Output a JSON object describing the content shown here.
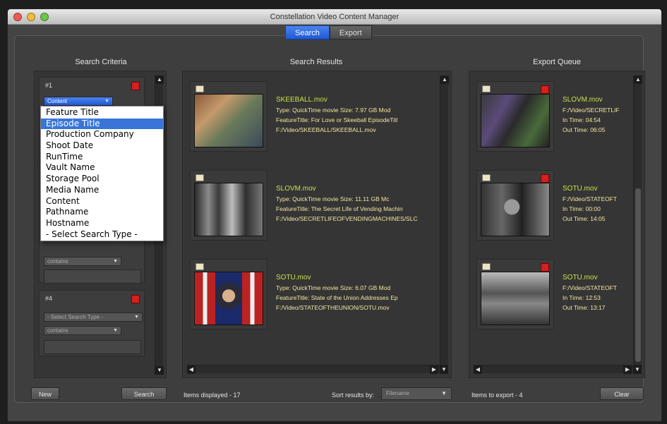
{
  "window": {
    "title": "Constellation Video Content Manager"
  },
  "tabs": [
    {
      "label": "Search",
      "active": true
    },
    {
      "label": "Export",
      "active": false
    }
  ],
  "sections": {
    "criteria": "Search Criteria",
    "results": "Search Results",
    "export": "Export Queue"
  },
  "criteria": [
    {
      "number": "#1",
      "type": "Content"
    },
    {
      "number": "",
      "type": "contains"
    },
    {
      "number": "#4",
      "type": "- Select Search Type -",
      "op": "contains"
    }
  ],
  "dropdown": {
    "selected_index": 1,
    "items": [
      "Feature Title",
      "Episode Title",
      "Production Company",
      "Shoot Date",
      "RunTime",
      "Vault Name",
      "Storage Pool",
      "Media Name",
      "Content",
      "Pathname",
      "Hostname",
      "- Select Search Type -"
    ]
  },
  "results": [
    {
      "filename": "SKEEBALL.mov",
      "line1": "Type: QuickTime movie   Size: 7.97 GB   Mod",
      "line2": "FeatureTitle: For Love or Skeeball   EpisodeTitl",
      "line3": "F:/Video/SKEEBALL/SKEEBALL.mov"
    },
    {
      "filename": "SLOVM.mov",
      "line1": "Type: QuickTime movie   Size: 11.11 GB   Mc",
      "line2": "FeatureTitle: The Secret Life of Vending Machin",
      "line3": "F:/Video/SECRETLIFEOFVENDINGMACHINES/SLC"
    },
    {
      "filename": "SOTU.mov",
      "line1": "Type: QuickTime movie   Size: 6.07 GB   Mod",
      "line2": "FeatureTitle: State of the Union Addresses   Ep",
      "line3": "F:/Video/STATEOFTHEUNION/SOTU.mov"
    }
  ],
  "export_queue": [
    {
      "filename": "SLOVM.mov",
      "path": "F:/Video/SECRETLIF",
      "in_time": "In Time: 04:54",
      "out_time": "Out Time: 06:05"
    },
    {
      "filename": "SOTU.mov",
      "path": "F:/Video/STATEOFT",
      "in_time": "In Time: 00:00",
      "out_time": "Out Time: 14:05"
    },
    {
      "filename": "SOTU.mov",
      "path": "F:/Video/STATEOFT",
      "in_time": "In Time: 12:53",
      "out_time": "Out Time: 13:17"
    }
  ],
  "footer": {
    "new_label": "New",
    "search_label": "Search",
    "items_displayed": "Items displayed - 17",
    "sort_label": "Sort results by:",
    "sort_value": "Filename",
    "items_to_export": "Items to export - 4",
    "clear_label": "Clear"
  },
  "colors": {
    "accent": "#2a62dc",
    "filename": "#c8e04a",
    "meta": "#f3e6a1",
    "delete": "#d52020"
  }
}
